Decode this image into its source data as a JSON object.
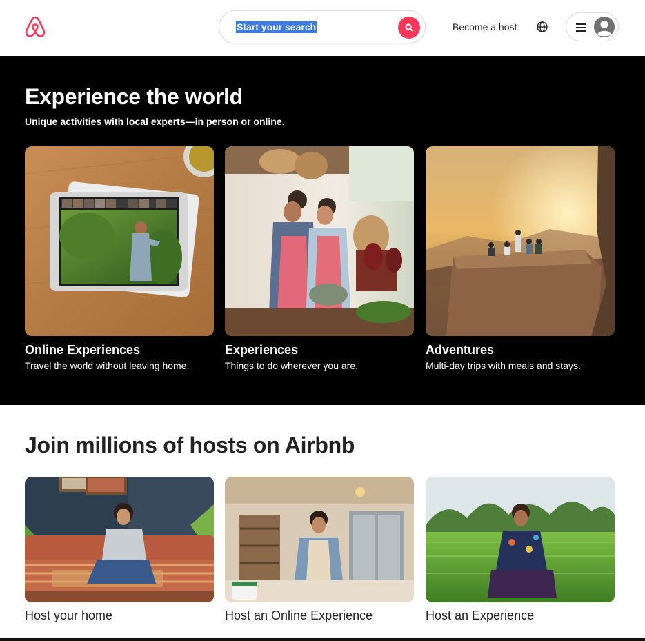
{
  "header": {
    "logo_icon": "airbnb-logo-icon",
    "search_placeholder": "Start your search",
    "search_icon": "search-icon",
    "become_host": "Become a host",
    "globe_icon": "globe-icon",
    "menu_icon": "hamburger-menu-icon",
    "avatar_icon": "user-avatar-icon",
    "brand_color": "#ff385c"
  },
  "experience": {
    "title": "Experience the world",
    "subtitle": "Unique activities with local experts—in person or online.",
    "cards": [
      {
        "title": "Online Experiences",
        "description": "Travel the world without leaving home."
      },
      {
        "title": "Experiences",
        "description": "Things to do wherever you are."
      },
      {
        "title": "Adventures",
        "description": "Multi-day trips with meals and stays."
      }
    ]
  },
  "hosts": {
    "title": "Join millions of hosts on Airbnb",
    "cards": [
      {
        "title": "Host your home"
      },
      {
        "title": "Host an Online Experience"
      },
      {
        "title": "Host an Experience"
      }
    ]
  }
}
